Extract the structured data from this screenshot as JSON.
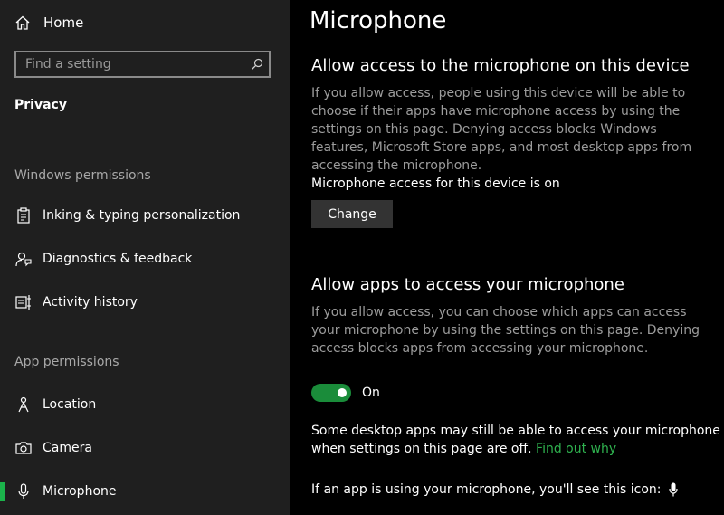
{
  "sidebar": {
    "home_label": "Home",
    "search_placeholder": "Find a setting",
    "section_title": "Privacy",
    "groups": [
      {
        "label": "Windows permissions"
      },
      {
        "label": "App permissions"
      }
    ],
    "items": [
      {
        "label": "Inking & typing personalization",
        "icon": "clipboard-icon"
      },
      {
        "label": "Diagnostics & feedback",
        "icon": "person-feedback-icon"
      },
      {
        "label": "Activity history",
        "icon": "timeline-icon"
      },
      {
        "label": "Location",
        "icon": "person-location-icon"
      },
      {
        "label": "Camera",
        "icon": "camera-icon"
      },
      {
        "label": "Microphone",
        "icon": "microphone-icon",
        "selected": true
      }
    ],
    "accent_color": "#1bb34b"
  },
  "main": {
    "title": "Microphone",
    "device_section": {
      "heading": "Allow access to the microphone on this device",
      "description": "If you allow access, people using this device will be able to choose if their apps have microphone access by using the settings on this page. Denying access blocks Windows features, Microsoft Store apps, and most desktop apps from accessing the microphone.",
      "status": "Microphone access for this device is on",
      "change_button": "Change"
    },
    "apps_section": {
      "heading": "Allow apps to access your microphone",
      "description": "If you allow access, you can choose which apps can access your microphone by using the settings on this page. Denying access blocks apps from accessing your microphone.",
      "toggle_state": "On",
      "note_line1": "Some desktop apps may still be able to access your microphone",
      "note_line2": "when settings on this page are off.",
      "note_link": "Find out why",
      "icon_note": "If an app is using your microphone, you'll see this icon:"
    }
  }
}
